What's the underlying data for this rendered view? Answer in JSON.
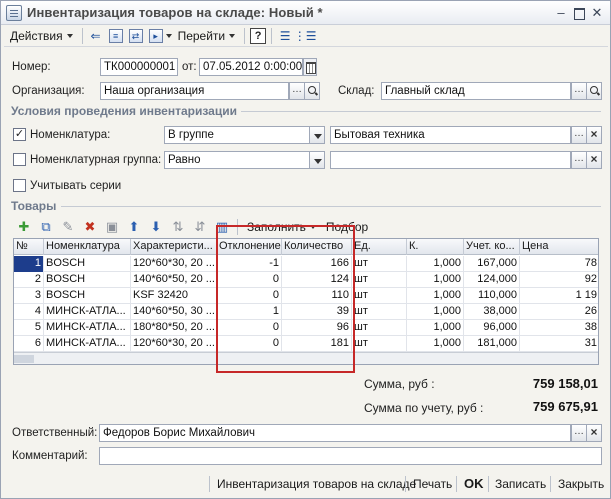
{
  "window": {
    "title": "Инвентаризация товаров на складе: Новый *"
  },
  "toolbar": {
    "actions_label": "Действия",
    "goto_label": "Перейти",
    "help_label": "?"
  },
  "form": {
    "number_label": "Номер:",
    "number_value": "ТК000000001",
    "from_label": "от:",
    "date_value": "07.05.2012  0:00:00",
    "org_label": "Организация:",
    "org_value": "Наша организация",
    "warehouse_label": "Склад:",
    "warehouse_value": "Главный склад"
  },
  "conditions": {
    "title": "Условия проведения инвентаризации",
    "nomenclature_label": "Номенклатура:",
    "nomenclature_checked": true,
    "nomenclature_mode": "В группе",
    "nomenclature_value": "Бытовая техника",
    "group_label": "Номенклатурная группа:",
    "group_checked": false,
    "group_mode": "Равно",
    "group_value": "",
    "series_label": "Учитывать серии",
    "series_checked": false
  },
  "goods": {
    "title": "Товары",
    "fill_label": "Заполнить",
    "select_label": "Подбор",
    "columns": [
      "№",
      "Номенклатура",
      "Характеристи...",
      "Отклонение",
      "Количество",
      "Ед.",
      "К.",
      "Учет. ко...",
      "Цена"
    ],
    "rows": [
      {
        "n": "1",
        "name": "BOSCH",
        "char": "120*60*30, 20 ...",
        "dev": "-1",
        "qty": "166",
        "unit": "шт",
        "k": "1,000",
        "acc": "167,000",
        "price": "78"
      },
      {
        "n": "2",
        "name": "BOSCH",
        "char": "140*60*50, 20 ...",
        "dev": "0",
        "qty": "124",
        "unit": "шт",
        "k": "1,000",
        "acc": "124,000",
        "price": "92"
      },
      {
        "n": "3",
        "name": "BOSCH",
        "char": "KSF 32420",
        "dev": "0",
        "qty": "110",
        "unit": "шт",
        "k": "1,000",
        "acc": "110,000",
        "price": "1 19"
      },
      {
        "n": "4",
        "name": "МИНСК-АТЛА...",
        "char": "140*60*50, 30 ...",
        "dev": "1",
        "qty": "39",
        "unit": "шт",
        "k": "1,000",
        "acc": "38,000",
        "price": "26"
      },
      {
        "n": "5",
        "name": "МИНСК-АТЛА...",
        "char": "180*80*50, 20 ...",
        "dev": "0",
        "qty": "96",
        "unit": "шт",
        "k": "1,000",
        "acc": "96,000",
        "price": "38"
      },
      {
        "n": "6",
        "name": "МИНСК-АТЛА...",
        "char": "120*60*30, 20 ...",
        "dev": "0",
        "qty": "181",
        "unit": "шт",
        "k": "1,000",
        "acc": "181,000",
        "price": "31"
      }
    ]
  },
  "totals": {
    "sum_label": "Сумма, руб :",
    "sum_value": "759 158,01",
    "acc_label": "Сумма по учету, руб :",
    "acc_value": "759 675,91"
  },
  "footer": {
    "responsible_label": "Ответственный:",
    "responsible_value": "Федоров Борис Михайлович",
    "comment_label": "Комментарий:",
    "comment_value": ""
  },
  "bottom": {
    "print_form_label": "Инвентаризация товаров на складе",
    "print_label": "Печать",
    "ok_label": "OK",
    "save_label": "Записать",
    "close_label": "Закрыть"
  },
  "colors": {
    "highlight_box": "#c62828",
    "selection": "#1d3d8c",
    "section_title": "#6f7a8c"
  }
}
